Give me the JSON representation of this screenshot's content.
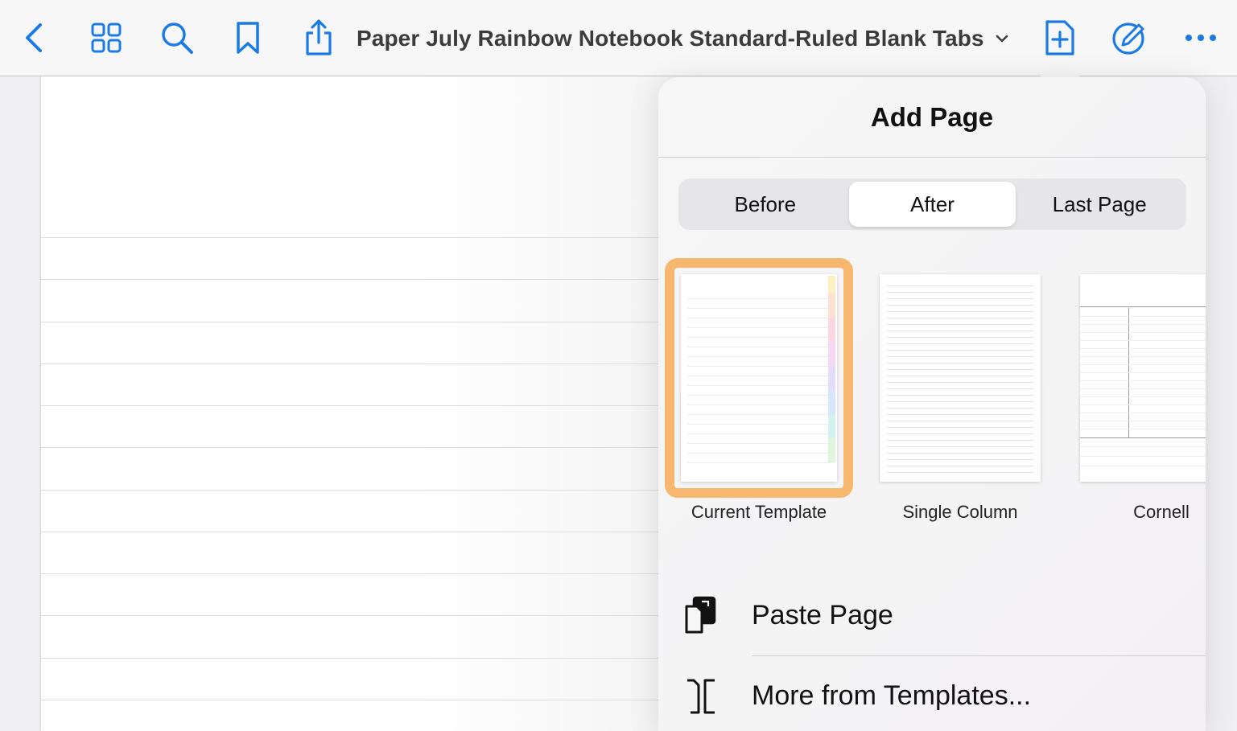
{
  "toolbar": {
    "title": "Paper July Rainbow Notebook Standard-Ruled Blank Tabs",
    "accent_color": "#1a7be6",
    "icons": [
      "back-chevron-icon",
      "grid-icon",
      "search-icon",
      "bookmark-icon",
      "share-icon",
      "title-chevron-down-icon",
      "add-page-icon",
      "pencil-circle-icon",
      "more-icon"
    ]
  },
  "add_page": {
    "title": "Add Page",
    "position_options": [
      {
        "label": "Before",
        "selected": false
      },
      {
        "label": "After",
        "selected": true
      },
      {
        "label": "Last Page",
        "selected": false
      }
    ],
    "templates": [
      {
        "label": "Current Template",
        "selected": true
      },
      {
        "label": "Single Column",
        "selected": false
      },
      {
        "label": "Cornell",
        "selected": false
      }
    ],
    "selection_color": "#f7b76e",
    "actions": [
      {
        "label": "Paste Page",
        "icon": "paste-page-icon"
      },
      {
        "label": "More from Templates...",
        "icon": "templates-icon"
      }
    ]
  }
}
